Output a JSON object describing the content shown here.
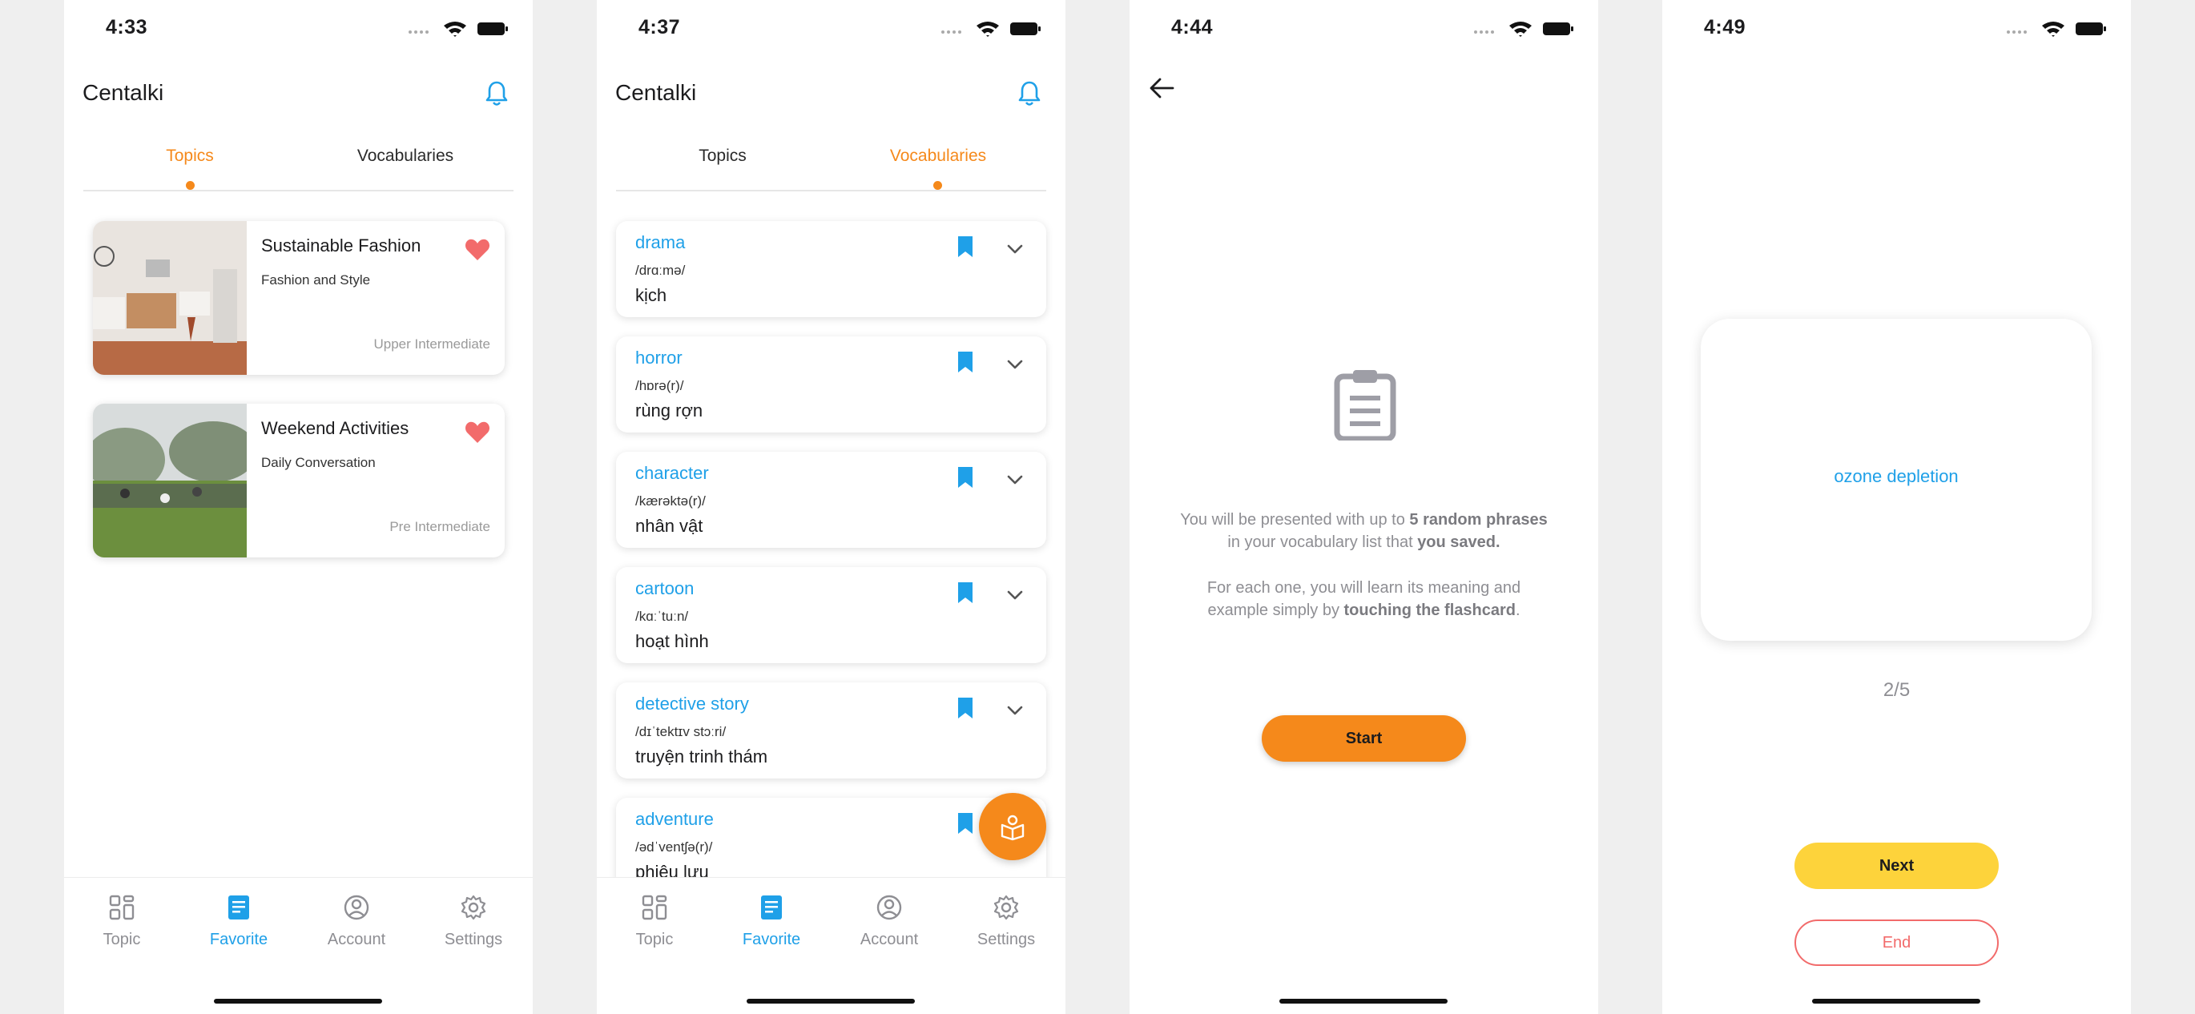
{
  "screen1": {
    "time": "4:33",
    "title": "Centalki",
    "tabs": [
      "Topics",
      "Vocabularies"
    ],
    "topics": [
      {
        "title": "Sustainable Fashion",
        "category": "Fashion and Style",
        "level": "Upper Intermediate"
      },
      {
        "title": "Weekend Activities",
        "category": "Daily Conversation",
        "level": "Pre Intermediate"
      }
    ]
  },
  "screen2": {
    "time": "4:37",
    "title": "Centalki",
    "tabs": [
      "Topics",
      "Vocabularies"
    ],
    "vocab": [
      {
        "word": "drama",
        "ipa": "/drɑːmə/",
        "meaning": "kịch"
      },
      {
        "word": "horror",
        "ipa": "/hɒrə(r)/",
        "meaning": "rùng rợn"
      },
      {
        "word": "character",
        "ipa": "/kærəktə(r)/",
        "meaning": "nhân vật"
      },
      {
        "word": "cartoon",
        "ipa": "/kɑːˈtuːn/",
        "meaning": "hoạt hình"
      },
      {
        "word": "detective story",
        "ipa": "/dɪˈtektɪv stɔːri/",
        "meaning": "truyện trinh thám"
      },
      {
        "word": "adventure",
        "ipa": "/ədˈventʃə(r)/",
        "meaning": "phiêu lưu"
      }
    ]
  },
  "screen3": {
    "time": "4:44",
    "para1": {
      "t1": "You will be presented with up to ",
      "b1": "5 random phrases",
      "t2": "in your vocabulary list that ",
      "b2": "you saved."
    },
    "para2": {
      "t1": "For each one, you will learn its meaning and",
      "t2": "example simply by ",
      "b1": "touching the flashcard",
      "t3": "."
    },
    "start_label": "Start"
  },
  "screen4": {
    "time": "4:49",
    "flashcard_text": "ozone depletion",
    "counter": "2/5",
    "next_label": "Next",
    "end_label": "End"
  },
  "nav": [
    "Topic",
    "Favorite",
    "Account",
    "Settings"
  ],
  "colors": {
    "accent": "#f5891b",
    "blue": "#1fa0e8",
    "yellow": "#fdd33b",
    "red": "#f26b6b",
    "grey": "#8e8e93"
  }
}
